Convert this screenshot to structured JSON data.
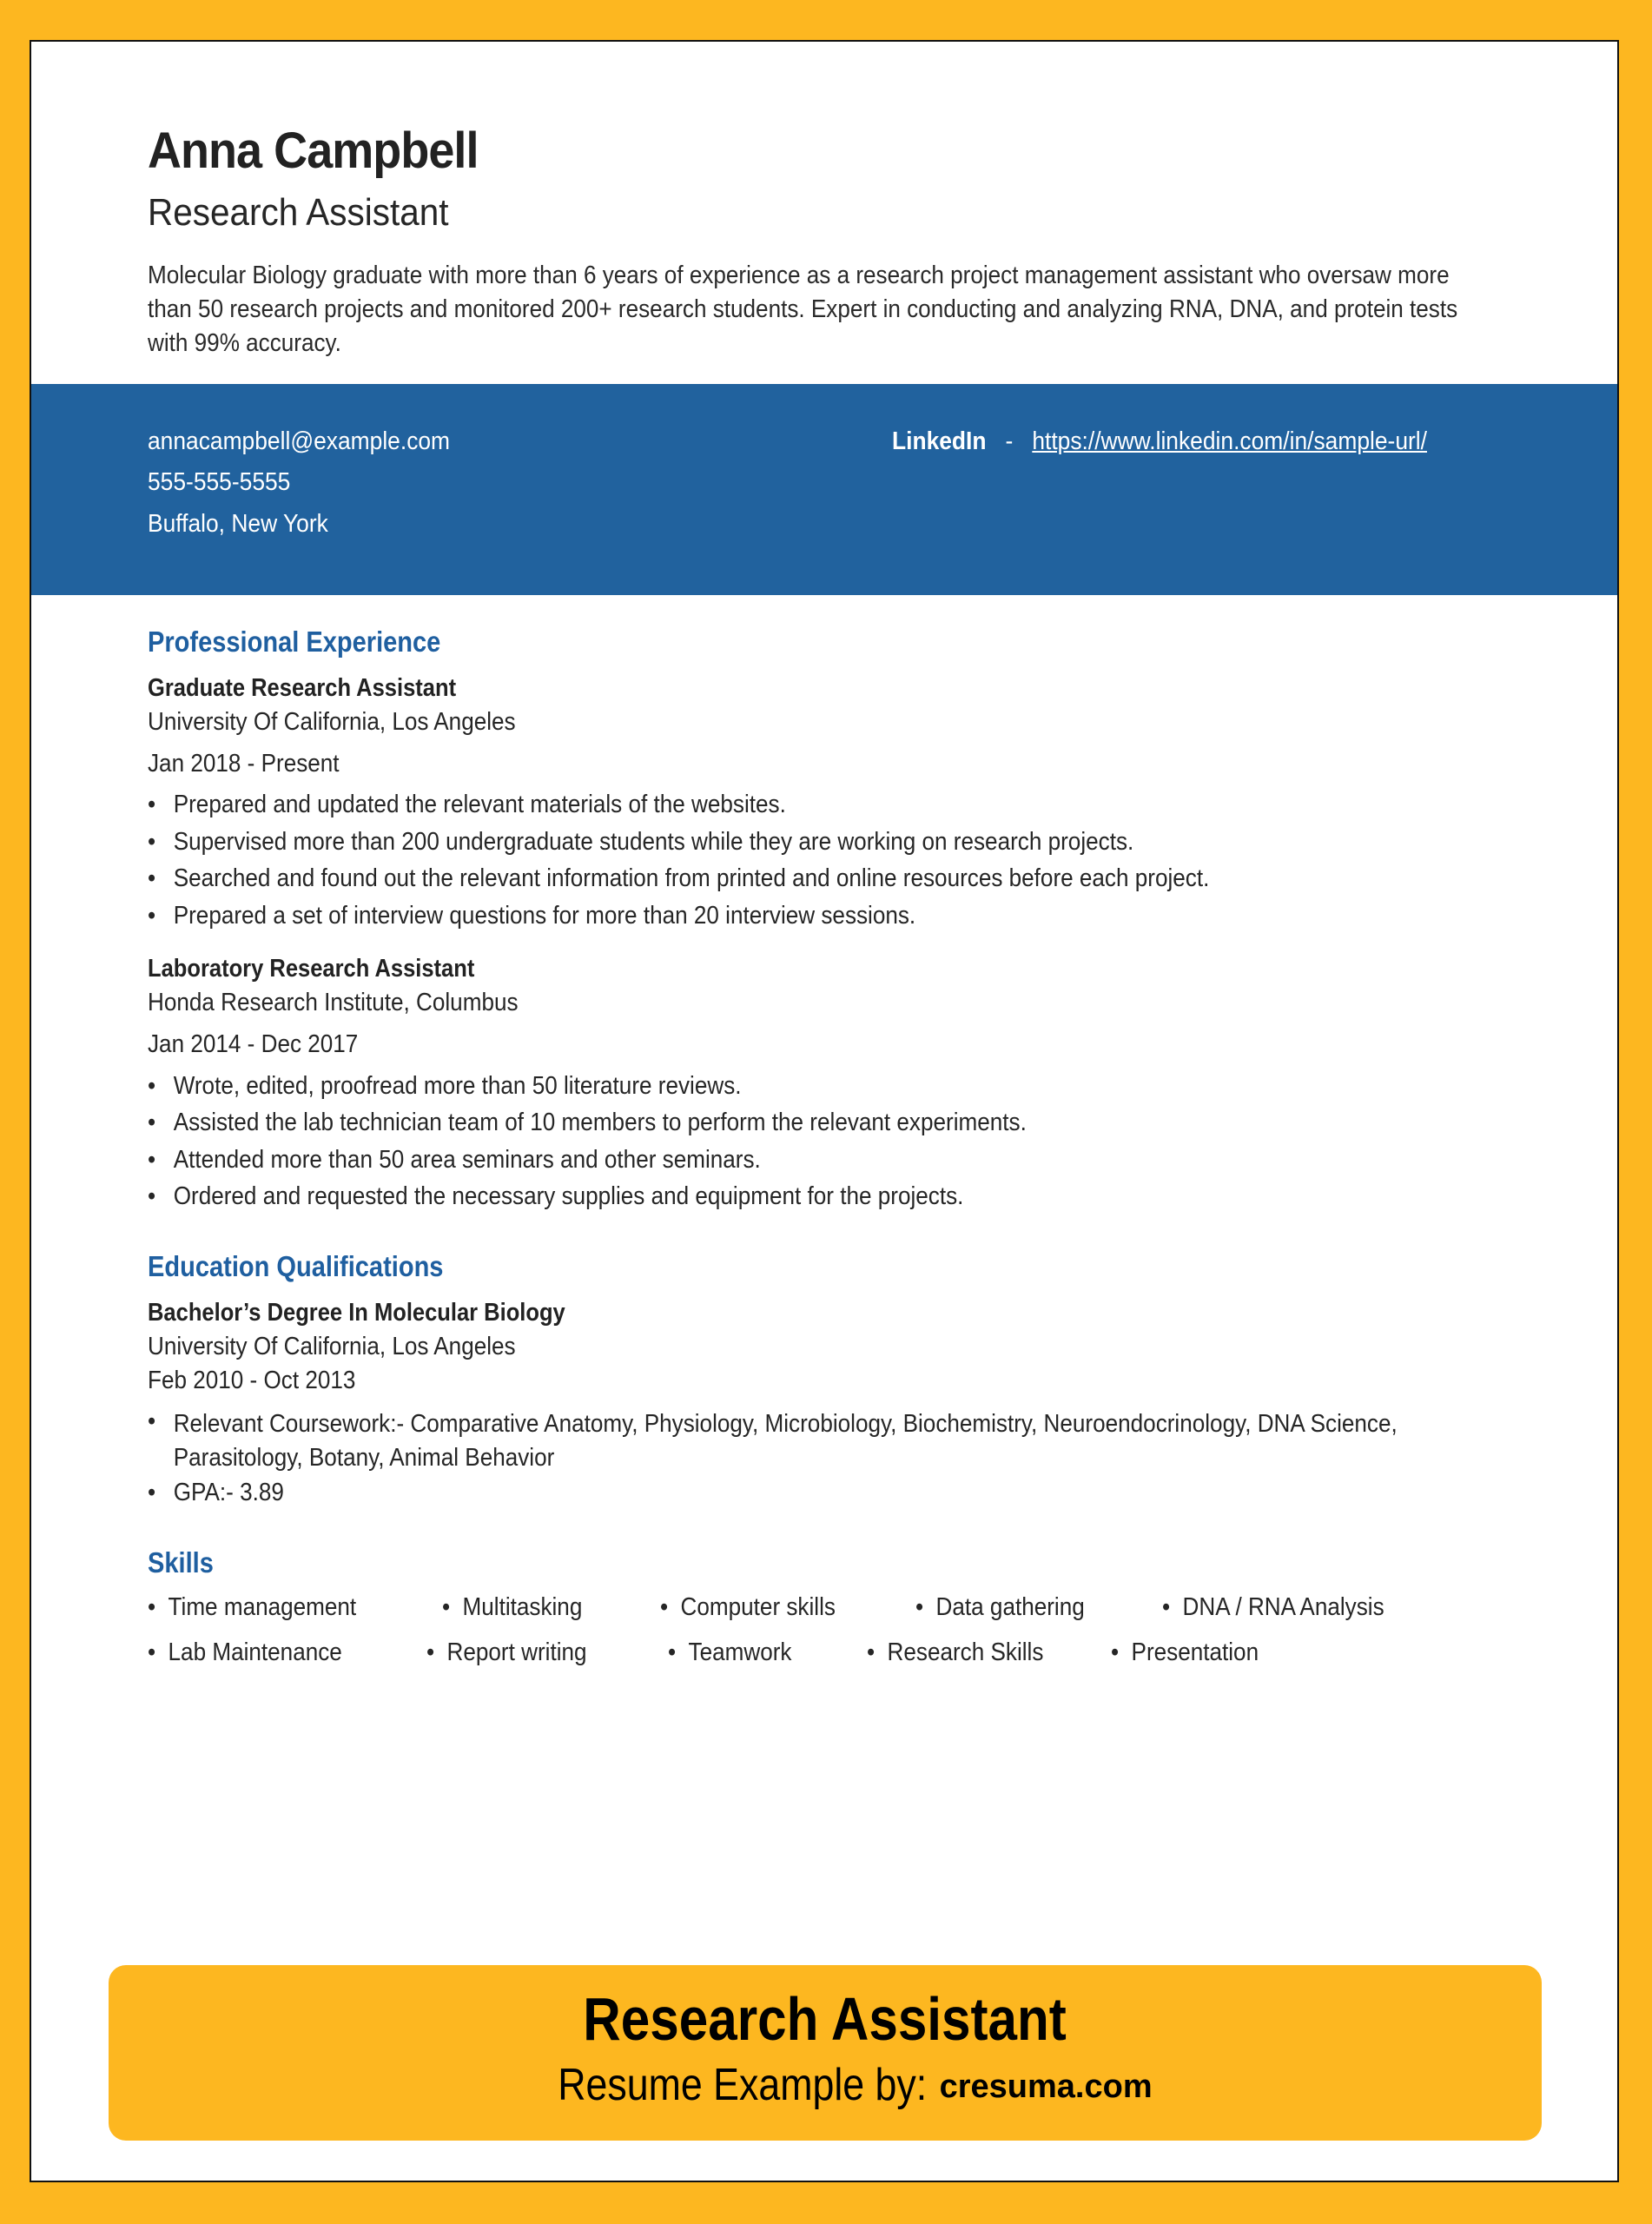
{
  "header": {
    "name": "Anna Campbell",
    "title": "Research Assistant",
    "summary": "Molecular Biology graduate with more than 6 years of experience as a research project management assistant who oversaw more than 50 research projects and monitored 200+ research students. Expert in conducting and analyzing RNA, DNA, and protein tests with 99% accuracy."
  },
  "contact": {
    "email": "annacampbell@example.com",
    "phone": "555-555-5555",
    "location": "Buffalo, New York",
    "linkedin_label": "LinkedIn",
    "linkedin_separator": "-",
    "linkedin_url": "https://www.linkedin.com/in/sample-url/"
  },
  "experience": {
    "heading": "Professional Experience",
    "jobs": [
      {
        "title": "Graduate Research Assistant",
        "company": "University Of California, Los Angeles",
        "dates": "Jan 2018 - Present",
        "bullets": [
          "Prepared and updated the relevant materials of the websites.",
          "Supervised more than 200 undergraduate students while they are working on research projects.",
          "Searched and found out the relevant information from printed and online resources before each project.",
          "Prepared a set of interview questions for more than 20 interview sessions."
        ]
      },
      {
        "title": "Laboratory Research Assistant",
        "company": "Honda Research Institute, Columbus",
        "dates": "Jan 2014 - Dec 2017",
        "bullets": [
          "Wrote, edited, proofread more than 50 literature reviews.",
          "Assisted the lab technician team of 10 members to perform the relevant experiments.",
          "Attended more than 50 area seminars and other seminars.",
          "Ordered and requested the necessary supplies and equipment for the projects."
        ]
      }
    ]
  },
  "education": {
    "heading": "Education Qualifications",
    "degree": "Bachelor’s Degree In Molecular Biology",
    "school": "University Of California, Los Angeles",
    "dates": "Feb 2010 - Oct 2013",
    "bullets": [
      "Relevant Coursework:- Comparative Anatomy, Physiology, Microbiology, Biochemistry, Neuroendocrinology, DNA Science, Parasitology, Botany, Animal Behavior",
      "GPA:- 3.89"
    ]
  },
  "skills": {
    "heading": "Skills",
    "row1": [
      "Time management",
      "Multitasking",
      "Computer skills",
      "Data gathering",
      "DNA / RNA Analysis"
    ],
    "row2": [
      "Lab Maintenance",
      "Report writing",
      "Teamwork",
      "Research Skills",
      "Presentation"
    ]
  },
  "banner": {
    "title": "Research Assistant",
    "subtitle": "Resume Example by:",
    "site": "cresuma.com"
  },
  "colors": {
    "frame": "#fdb720",
    "band": "#21629e",
    "heading": "#1f5fa0"
  },
  "icons": {
    "bullet": "•"
  }
}
